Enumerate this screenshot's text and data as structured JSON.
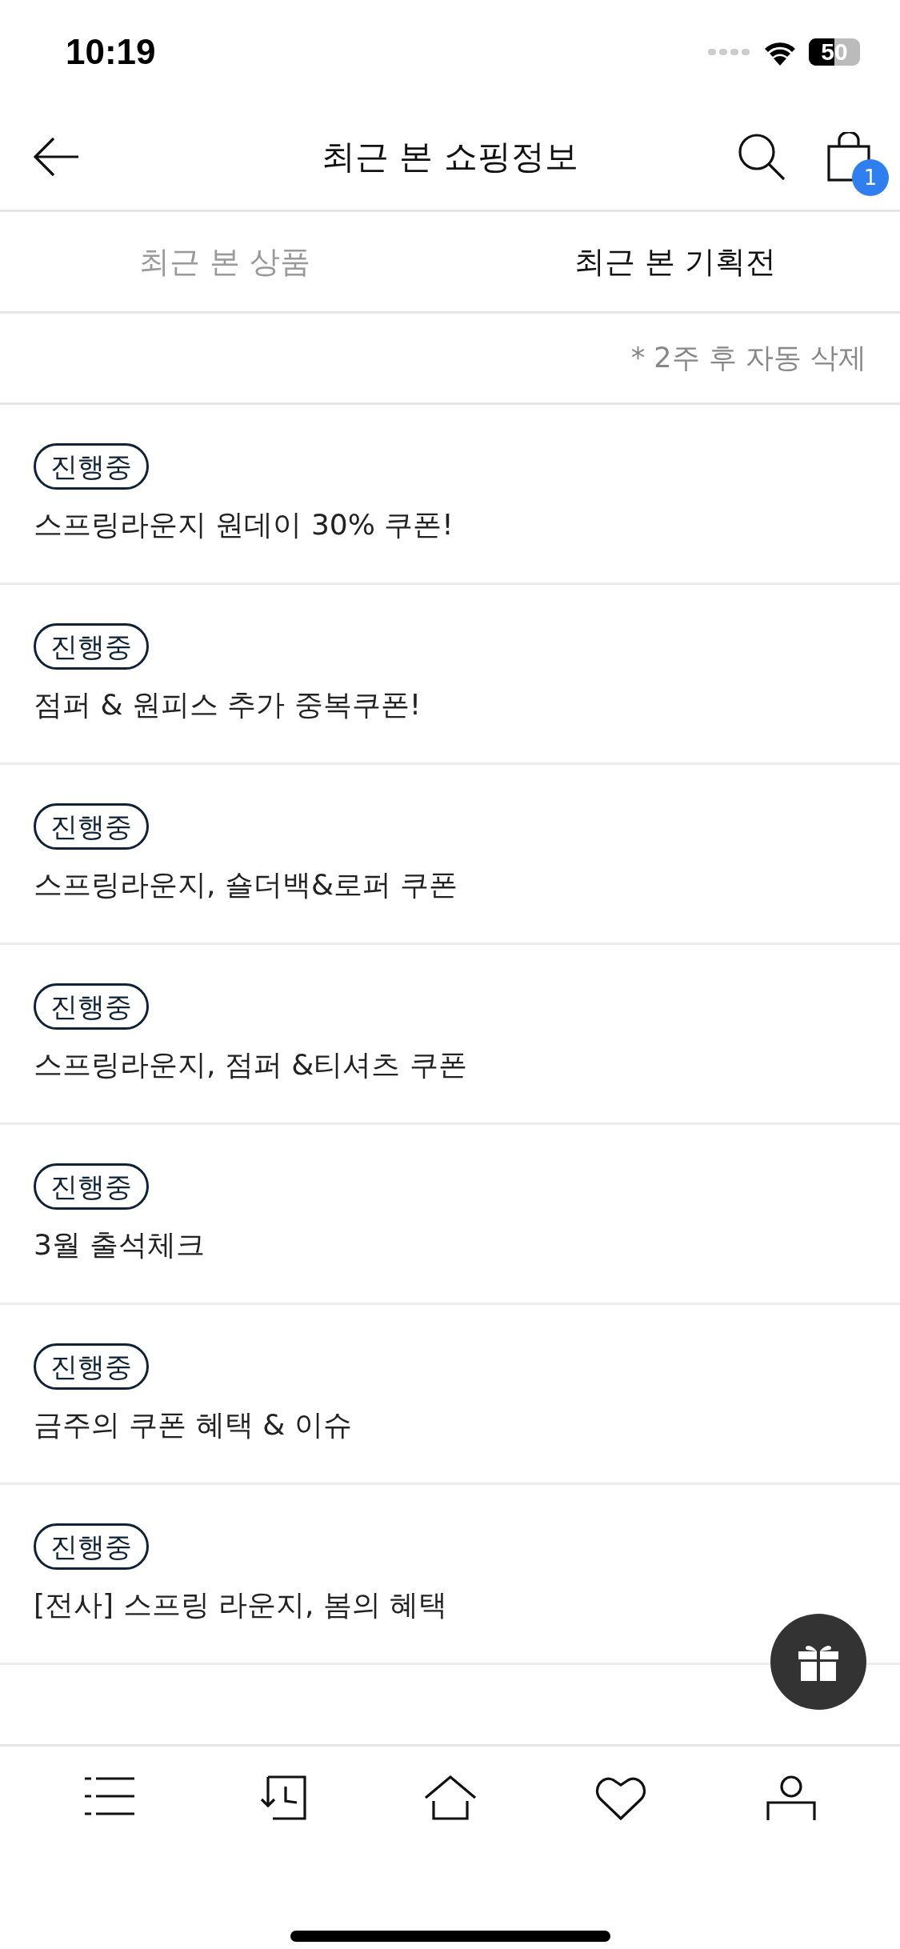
{
  "status_bar": {
    "time": "10:19",
    "battery": "50"
  },
  "header": {
    "title": "최근 본 쇼핑정보",
    "cart_count": "1"
  },
  "tabs": [
    {
      "label": "최근 본 상품",
      "selected": false
    },
    {
      "label": "최근 본 기획전",
      "selected": true
    }
  ],
  "note": "* 2주 후 자동 삭제",
  "events": [
    {
      "status": "진행중",
      "title": "스프링라운지 원데이 30% 쿠폰!"
    },
    {
      "status": "진행중",
      "title": "점퍼 & 원피스 추가 중복쿠폰!"
    },
    {
      "status": "진행중",
      "title": "스프링라운지, 숄더백&로퍼 쿠폰"
    },
    {
      "status": "진행중",
      "title": "스프링라운지, 점퍼 &티셔츠 쿠폰"
    },
    {
      "status": "진행중",
      "title": "3월 출석체크"
    },
    {
      "status": "진행중",
      "title": "금주의 쿠폰 혜택 & 이슈"
    },
    {
      "status": "진행중",
      "title": "[전사] 스프링 라운지, 봄의 혜택"
    }
  ],
  "bottom_nav": [
    {
      "kind": "menu"
    },
    {
      "kind": "recent"
    },
    {
      "kind": "home"
    },
    {
      "kind": "heart"
    },
    {
      "kind": "person"
    }
  ]
}
